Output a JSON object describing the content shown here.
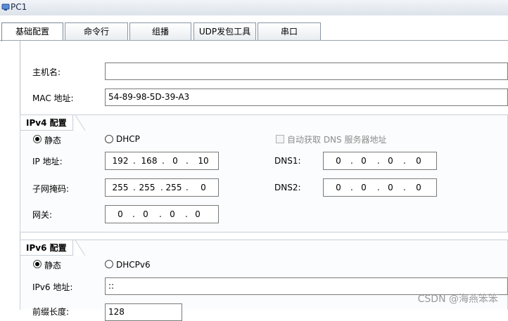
{
  "window": {
    "title": "PC1"
  },
  "tabs": [
    {
      "label": "基础配置",
      "active": true
    },
    {
      "label": "命令行",
      "active": false
    },
    {
      "label": "组播",
      "active": false
    },
    {
      "label": "UDP发包工具",
      "active": false
    },
    {
      "label": "串口",
      "active": false
    }
  ],
  "basic": {
    "hostname_label": "主机名:",
    "hostname_value": "",
    "mac_label": "MAC 地址:",
    "mac_value": "54-89-98-5D-39-A3"
  },
  "ipv4": {
    "section_title": "IPv4 配置",
    "static_label": "静态",
    "dhcp_label": "DHCP",
    "mode": "static",
    "auto_dns_label": "自动获取 DNS 服务器地址",
    "ip_label": "IP 地址:",
    "ip": [
      "192",
      "168",
      "0",
      "10"
    ],
    "mask_label": "子网掩码:",
    "mask": [
      "255",
      "255",
      "255",
      "0"
    ],
    "gateway_label": "网关:",
    "gateway": [
      "0",
      "0",
      "0",
      "0"
    ],
    "dns1_label": "DNS1:",
    "dns1": [
      "0",
      "0",
      "0",
      "0"
    ],
    "dns2_label": "DNS2:",
    "dns2": [
      "0",
      "0",
      "0",
      "0"
    ]
  },
  "ipv6": {
    "section_title": "IPv6 配置",
    "static_label": "静态",
    "dhcp_label": "DHCPv6",
    "mode": "static",
    "ip_label": "IPv6 地址:",
    "ip_value": "::",
    "prefix_label": "前缀长度:",
    "prefix_value": "128"
  },
  "watermark": "CSDN @海燕笨笨",
  "colors": {
    "accent": "#2a64c5",
    "border": "#7a7a7a"
  }
}
